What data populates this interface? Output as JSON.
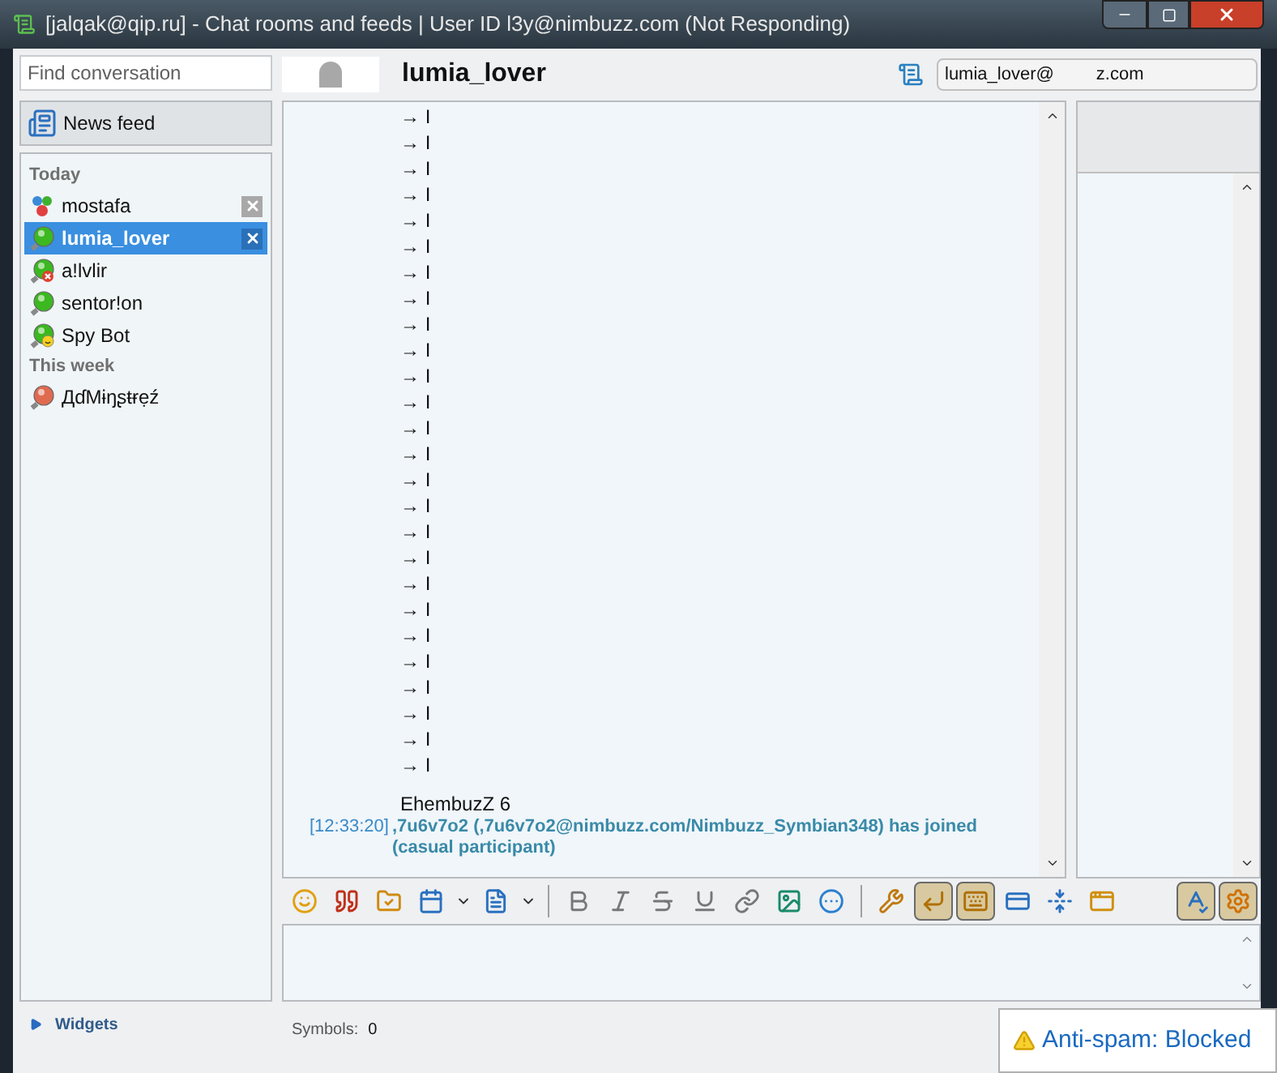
{
  "window": {
    "title": "[jalqak@qip.ru] - Chat rooms and feeds | User ID l3y@nimbuzz.com (Not Responding)"
  },
  "sidebar": {
    "search": {
      "placeholder": "Find conversation"
    },
    "news_feed": "News feed",
    "groups": [
      {
        "label": "Today",
        "items": [
          {
            "name": "mostafa",
            "kind": "group",
            "selected": false,
            "closable": true
          },
          {
            "name": "lumia_lover",
            "kind": "online",
            "selected": true,
            "closable": true
          },
          {
            "name": "a!lvlir",
            "kind": "blocked",
            "selected": false,
            "closable": false
          },
          {
            "name": "sentor!on",
            "kind": "online",
            "selected": false,
            "closable": false
          },
          {
            "name": "Spy Bot",
            "kind": "bot",
            "selected": false,
            "closable": false
          }
        ]
      },
      {
        "label": "This week",
        "items": [
          {
            "name": "ДɗМɨŋʂŧɍẹź",
            "kind": "offline",
            "selected": false,
            "closable": false
          }
        ]
      }
    ],
    "widgets": "Widgets"
  },
  "chat": {
    "title": "lumia_lover",
    "jid_left": "lumia_lover@",
    "jid_right": "z.com",
    "lines": [
      "→ I",
      "→ I",
      "→ I",
      "→ I",
      "→ I",
      "→ I",
      "→ I",
      "→ I",
      "→ I",
      "→ I",
      "→ I",
      "→ I",
      "→ I",
      "→ I",
      "→ I",
      "→ I",
      "→ I",
      "→ I",
      "→ I",
      "→ I",
      "→ I",
      "→ I",
      "→ I",
      "→ I",
      "→ I",
      "→ I"
    ],
    "last_line": "EhembuzZ 6",
    "event": {
      "time": "[12:33:20]",
      "text": ",7u6v7o2 (,7u6v7o2@nimbuzz.com/Nimbuzz_Symbian348) has joined (casual participant)"
    }
  },
  "toolbar": {
    "tools": [
      {
        "kind": "smile"
      },
      {
        "kind": "quote"
      },
      {
        "kind": "folder"
      },
      {
        "kind": "calendar"
      },
      {
        "kind": "caret"
      },
      {
        "kind": "file"
      },
      {
        "kind": "caret"
      },
      {
        "kind": "sep"
      },
      {
        "kind": "bold"
      },
      {
        "kind": "italic"
      },
      {
        "kind": "strike"
      },
      {
        "kind": "underline"
      },
      {
        "kind": "link"
      },
      {
        "kind": "image"
      },
      {
        "kind": "more"
      },
      {
        "kind": "sep"
      },
      {
        "kind": "tools"
      },
      {
        "kind": "enter",
        "pressed": true
      },
      {
        "kind": "keyboard",
        "pressed": true
      },
      {
        "kind": "card"
      },
      {
        "kind": "fit"
      },
      {
        "kind": "windows"
      }
    ],
    "right_tools": [
      {
        "kind": "spell",
        "pressed": true
      },
      {
        "kind": "settings",
        "pressed": true
      }
    ]
  },
  "status_bar": {
    "symbols_label": "Symbols:",
    "symbols_count": "0"
  },
  "notification": {
    "title": "Anti-spam: Blocked"
  }
}
